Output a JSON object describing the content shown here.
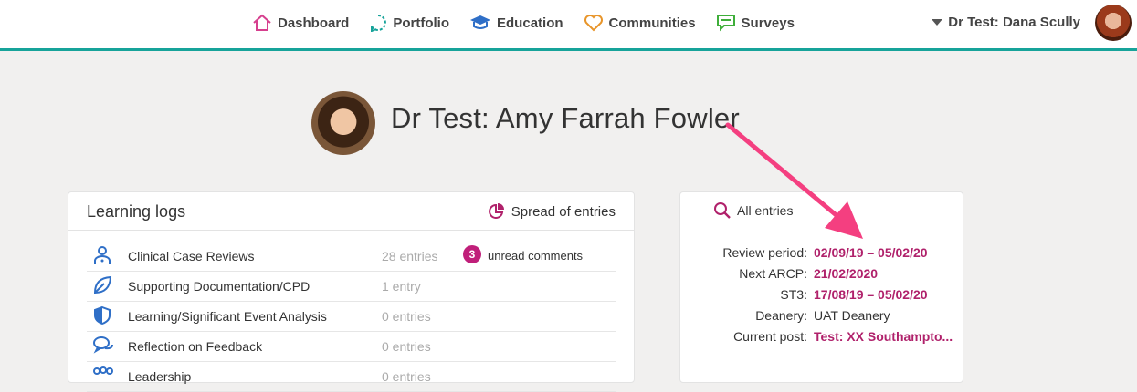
{
  "nav": {
    "items": [
      {
        "label": "Dashboard",
        "icon": "home-icon",
        "color": "#d63f8e"
      },
      {
        "label": "Portfolio",
        "icon": "portfolio-icon",
        "color": "#17a39a"
      },
      {
        "label": "Education",
        "icon": "graduation-cap-icon",
        "color": "#2f6fc7"
      },
      {
        "label": "Communities",
        "icon": "heart-icon",
        "color": "#e8952a"
      },
      {
        "label": "Surveys",
        "icon": "chat-icon",
        "color": "#3fae3a"
      }
    ],
    "user_label": "Dr Test: Dana Scully"
  },
  "profile": {
    "name": "Dr Test: Amy Farrah Fowler"
  },
  "learning_logs": {
    "title": "Learning logs",
    "spread_label": "Spread of entries",
    "rows": [
      {
        "label": "Clinical Case Reviews",
        "count": "28 entries",
        "icon": "doctor-icon",
        "badge": "3",
        "badge_label": "unread comments"
      },
      {
        "label": "Supporting Documentation/CPD",
        "count": "1 entry",
        "icon": "leaf-icon"
      },
      {
        "label": "Learning/Significant Event Analysis",
        "count": "0 entries",
        "icon": "shield-icon"
      },
      {
        "label": "Reflection on Feedback",
        "count": "0 entries",
        "icon": "speech-bubbles-icon"
      },
      {
        "label": "Leadership",
        "count": "0 entries",
        "icon": "people-icon"
      }
    ]
  },
  "info": {
    "all_entries_label": "All entries",
    "rows": [
      {
        "key": "Review period:",
        "value": "02/09/19 – 05/02/20"
      },
      {
        "key": "Next ARCP:",
        "value": "21/02/2020"
      },
      {
        "key": "ST3:",
        "value": "17/08/19 – 05/02/20"
      },
      {
        "key": "Deanery:",
        "value": "UAT Deanery"
      },
      {
        "key": "Current post:",
        "value": "Test: XX Southampto..."
      }
    ]
  },
  "colors": {
    "accent": "#17a39a",
    "highlight": "#b0216b",
    "arrow": "#f43f80",
    "badge": "#c01f7a"
  }
}
